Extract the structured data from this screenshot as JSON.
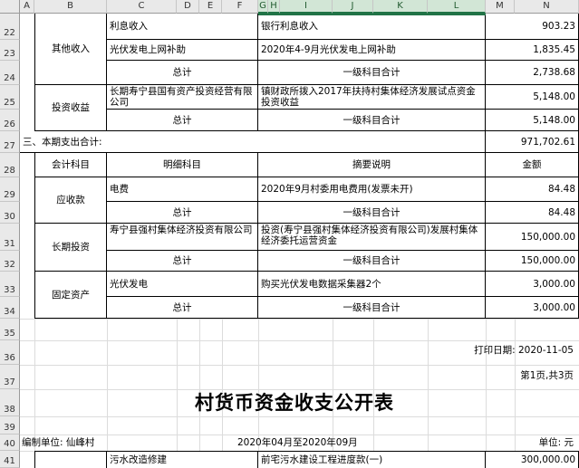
{
  "columns": [
    "A",
    "B",
    "C",
    "D",
    "E",
    "F",
    "G",
    "H",
    "I",
    "J",
    "K",
    "L",
    "M",
    "N"
  ],
  "rows": [
    "22",
    "23",
    "24",
    "25",
    "26",
    "27",
    "28",
    "29",
    "30",
    "31",
    "32",
    "33",
    "34",
    "35",
    "36",
    "37",
    "38",
    "39",
    "40",
    "41"
  ],
  "income": {
    "other_income_label": "其他收入",
    "interest_detail": "利息收入",
    "interest_summary": "银行利息收入",
    "interest_amount": "903.23",
    "pv_detail": "光伏发电上网补助",
    "pv_summary": "2020年4-9月光伏发电上网补助",
    "pv_amount": "1,835.45",
    "other_total_label": "总计",
    "other_total_summary": "一级科目合计",
    "other_total_amount": "2,738.68",
    "invest_label": "投资收益",
    "invest_detail": "长期寿宁县国有资产投资经营有限公司",
    "invest_summary": "镇财政所拨入2017年扶持村集体经济发展试点资金投资收益",
    "invest_amount": "5,148.00",
    "invest_total_label": "总计",
    "invest_total_summary": "一级科目合计",
    "invest_total_amount": "5,148.00"
  },
  "expense": {
    "section_label": "三、本期支出合计:",
    "section_amount": "971,702.61",
    "header": {
      "subject": "会计科目",
      "detail": "明细科目",
      "summary": "摘要说明",
      "amount": "金额"
    },
    "receivable_label": "应收款",
    "elec_detail": "电费",
    "elec_summary": "2020年9月村委用电费用(发票未开)",
    "elec_amount": "84.48",
    "receivable_total_label": "总计",
    "receivable_total_summary": "一级科目合计",
    "receivable_total_amount": "84.48",
    "lt_invest_label": "长期投资",
    "lt_invest_detail": "寿宁县强村集体经济投资有限公司",
    "lt_invest_summary": "投资(寿宁县强村集体经济投资有限公司)发展村集体经济委托运营资金",
    "lt_invest_amount": "150,000.00",
    "lt_total_label": "总计",
    "lt_total_summary": "一级科目合计",
    "lt_total_amount": "150,000.00",
    "fixed_label": "固定资产",
    "fixed_detail": "光伏发电",
    "fixed_summary": "购买光伏发电数据采集器2个",
    "fixed_amount": "3,000.00",
    "fixed_total_label": "总计",
    "fixed_total_summary": "一级科目合计",
    "fixed_total_amount": "3,000.00"
  },
  "page2": {
    "print_date": "打印日期: 2020-11-05",
    "page_info": "第1页,共3页",
    "title": "村货币资金收支公开表",
    "org": "编制单位: 仙峰村",
    "period": "2020年04月至2020年09月",
    "unit": "单位: 元",
    "r41_detail": "污水改造修建",
    "r41_summary": "前宅污水建设工程进度款(一)",
    "r41_amount": "300,000.00"
  },
  "colors": {
    "selection": "#217346",
    "header_bg": "#e9e9e9"
  }
}
